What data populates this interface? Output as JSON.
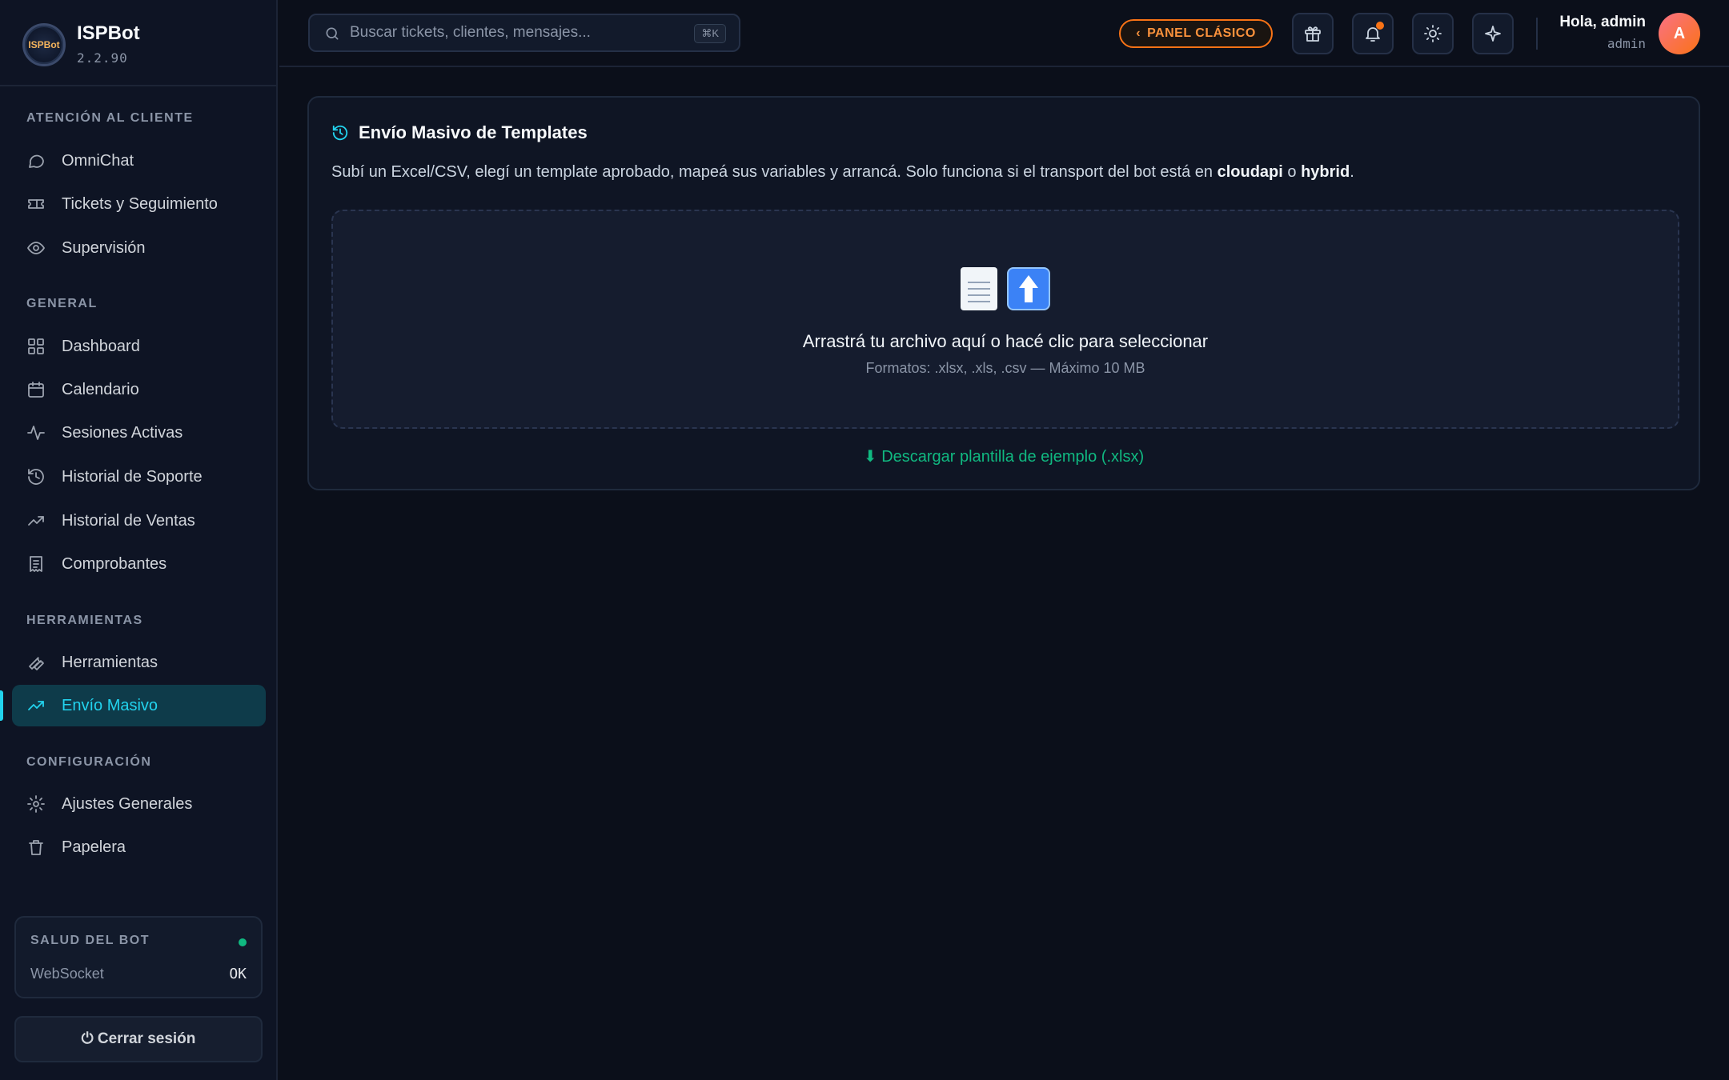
{
  "brand": {
    "name": "ISPBot",
    "version": "2.2.90",
    "logo_text": "ISPBot"
  },
  "sidebar": {
    "sections": [
      {
        "title": "ATENCIÓN AL CLIENTE"
      },
      {
        "title": "GENERAL"
      },
      {
        "title": "HERRAMIENTAS"
      },
      {
        "title": "CONFIGURACIÓN"
      }
    ],
    "items": [
      {
        "label": "OmniChat",
        "icon": "chat-bubble-icon"
      },
      {
        "label": "Tickets y Seguimiento",
        "icon": "ticket-icon"
      },
      {
        "label": "Supervisión",
        "icon": "eye-icon"
      },
      {
        "label": "Dashboard",
        "icon": "grid-icon"
      },
      {
        "label": "Calendario",
        "icon": "calendar-icon"
      },
      {
        "label": "Sesiones Activas",
        "icon": "activity-icon"
      },
      {
        "label": "Historial de Soporte",
        "icon": "history-icon"
      },
      {
        "label": "Historial de Ventas",
        "icon": "trending-up-icon"
      },
      {
        "label": "Comprobantes",
        "icon": "receipt-icon"
      },
      {
        "label": "Herramientas",
        "icon": "wrench-icon"
      },
      {
        "label": "Envío Masivo",
        "icon": "trending-up-icon",
        "active": true
      },
      {
        "label": "Ajustes Generales",
        "icon": "gear-icon"
      },
      {
        "label": "Papelera",
        "icon": "trash-icon"
      }
    ],
    "health": {
      "title": "SALUD DEL BOT",
      "label": "WebSocket",
      "value": "OK",
      "status_color": "#10b981"
    },
    "logout_label": "⏻ Cerrar sesión"
  },
  "header": {
    "search": {
      "placeholder": "Buscar tickets, clientes, mensajes...",
      "shortcut": "⌘K"
    },
    "classic_panel_label": "PANEL CLÁSICO",
    "greeting": "Hola, admin",
    "role": "admin",
    "avatar_initial": "A"
  },
  "main": {
    "title": "Envío Masivo de Templates",
    "description_pre": "Subí un Excel/CSV, elegí un template aprobado, mapeá sus variables y arrancá. Solo funciona si el transport del bot está en ",
    "description_b1": "cloudapi",
    "description_mid": " o ",
    "description_b2": "hybrid",
    "description_post": ".",
    "dropzone": {
      "main_text": "Arrastrá tu archivo aquí o hacé clic para seleccionar",
      "sub_text": "Formatos: .xlsx, .xls, .csv — Máximo 10 MB"
    },
    "download_label": "⬇ Descargar plantilla de ejemplo (.xlsx)"
  },
  "colors": {
    "accent": "#22d3ee",
    "orange": "#f97316",
    "success": "#10b981"
  }
}
